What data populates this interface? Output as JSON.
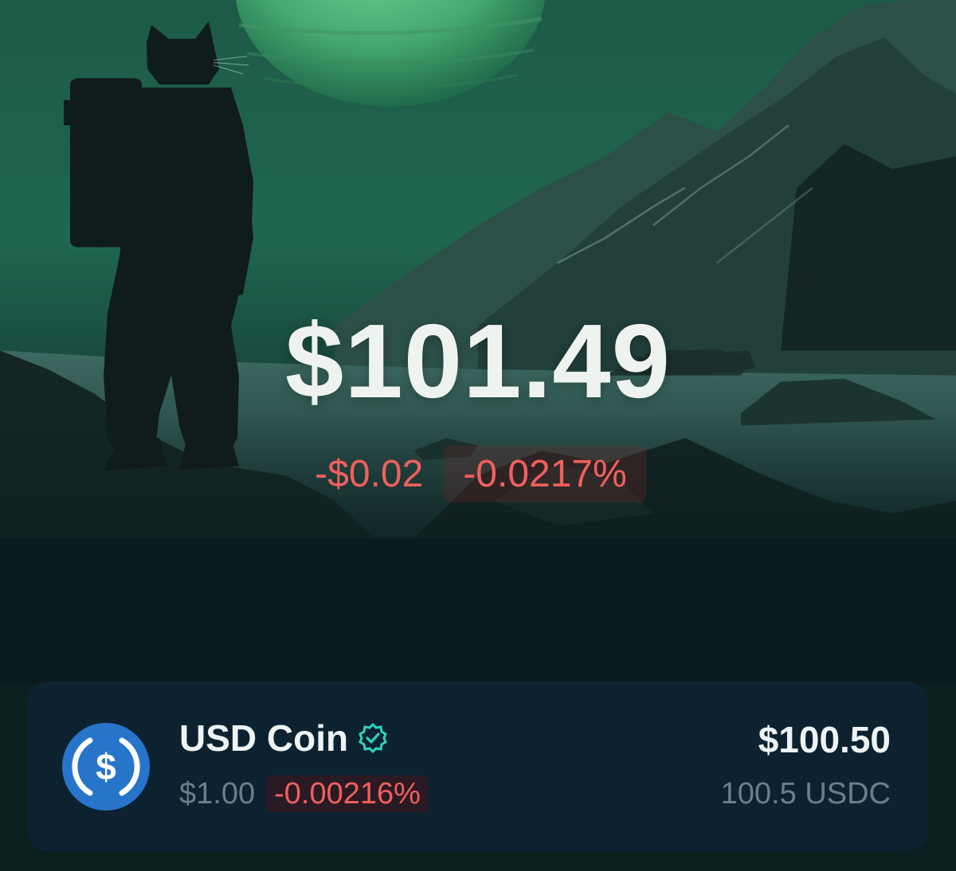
{
  "portfolio": {
    "balance": "$101.49",
    "change_abs": "-$0.02",
    "change_pct": "-0.0217%"
  },
  "token": {
    "name": "USD Coin",
    "icon": "usdc-icon",
    "verified_icon": "verified-badge-icon",
    "price": "$1.00",
    "change_pct": "-0.00216%",
    "value": "$100.50",
    "amount": "100.5 USDC"
  },
  "colors": {
    "negative": "#f0605d",
    "token_brand": "#2775ca",
    "verified": "#2dd4bf",
    "card_bg": "#0d2230"
  }
}
